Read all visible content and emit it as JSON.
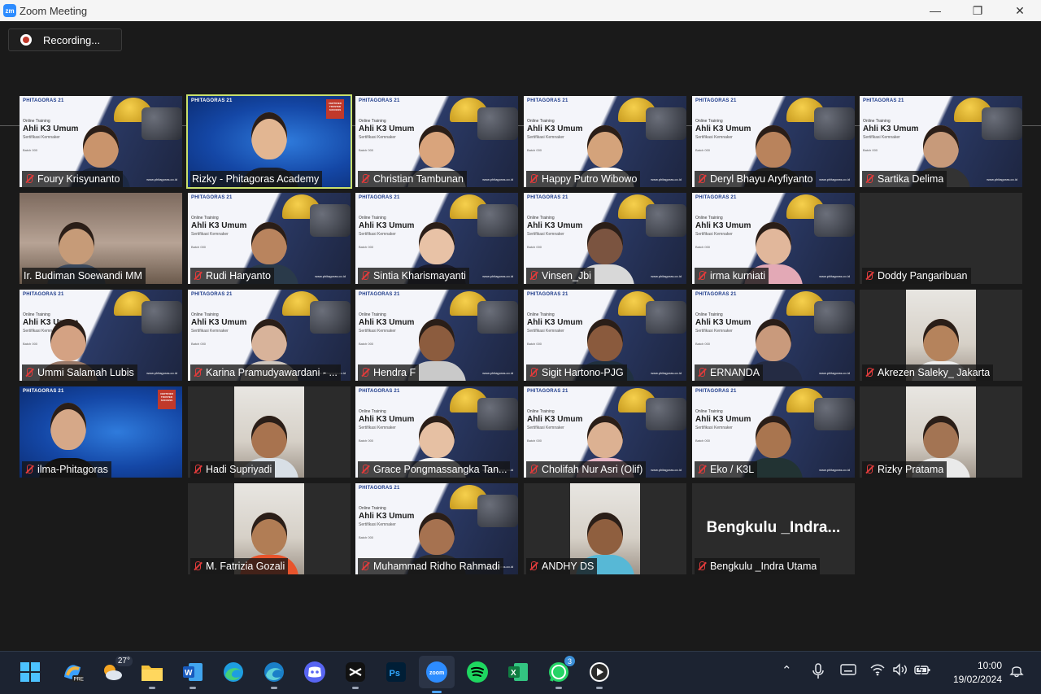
{
  "window": {
    "app_logo": "zm",
    "title": "Zoom Meeting",
    "minimize_icon": "minimize-icon",
    "restore_icon": "restore-icon",
    "close_icon": "close-icon"
  },
  "recording": {
    "label": "Recording..."
  },
  "banner": {
    "brand": "PHITAGORAS 21",
    "subtitle": "Online Training",
    "title": "Ahli K3 Umum",
    "certification": "Sertifikasi Kemnaker",
    "batch": "Batch 000",
    "website": "www.phitagoras.co.id",
    "badge": "CERTIFIED TRUSTED SUCCESS"
  },
  "participants": [
    {
      "name": "Foury Krisyunanto",
      "muted": true
    },
    {
      "name": "Rizky - Phitagoras Academy",
      "muted": false,
      "active_speaker": true
    },
    {
      "name": "Christian Tambunan",
      "muted": true
    },
    {
      "name": "Happy Putro Wibowo",
      "muted": true
    },
    {
      "name": "Deryl Bhayu Aryfiyanto",
      "muted": true
    },
    {
      "name": "Sartika Delima",
      "muted": true
    },
    {
      "name": "Ir. Budiman Soewandi MM",
      "muted": false
    },
    {
      "name": "Rudi Haryanto",
      "muted": true
    },
    {
      "name": "Sintia Kharismayanti",
      "muted": true
    },
    {
      "name": "Vinsen_Jbi",
      "muted": true
    },
    {
      "name": "irma kurniati",
      "muted": true
    },
    {
      "name": "Doddy Pangaribuan",
      "muted": true
    },
    {
      "name": "Ummi Salamah Lubis",
      "muted": true
    },
    {
      "name": "Karina Pramudyawardani - ...",
      "muted": true
    },
    {
      "name": "Hendra F",
      "muted": true
    },
    {
      "name": "Sigit Hartono-PJG",
      "muted": true
    },
    {
      "name": "ERNANDA",
      "muted": true
    },
    {
      "name": "Akrezen Saleky_ Jakarta",
      "muted": true
    },
    {
      "name": "ilma-Phitagoras",
      "muted": true
    },
    {
      "name": "Hadi Supriyadi",
      "muted": true
    },
    {
      "name": "Grace Pongmassangka Tan...",
      "muted": true
    },
    {
      "name": "Cholifah Nur Asri (Olif)",
      "muted": true
    },
    {
      "name": "Eko / K3L",
      "muted": true
    },
    {
      "name": "Rizky Pratama",
      "muted": true
    },
    {
      "name": "M. Fatrizia Gozali",
      "muted": true
    },
    {
      "name": "Muhammad Ridho Rahmadi",
      "muted": true
    },
    {
      "name": "ANDHY DS",
      "muted": true
    },
    {
      "name": "Bengkulu _Indra Utama",
      "muted": true,
      "display_text": "Bengkulu _Indra..."
    }
  ],
  "taskbar": {
    "weather_temp": "27°",
    "whatsapp_badge": "3",
    "time": "10:00",
    "date": "19/02/2024",
    "icons": [
      "start-icon",
      "copilot-icon",
      "weather-icon",
      "file-explorer-icon",
      "word-icon",
      "edge-icon",
      "edge-dev-icon",
      "discord-icon",
      "capcut-icon",
      "photoshop-icon",
      "zoom-icon",
      "spotify-icon",
      "excel-icon",
      "whatsapp-icon",
      "media-player-icon"
    ]
  }
}
